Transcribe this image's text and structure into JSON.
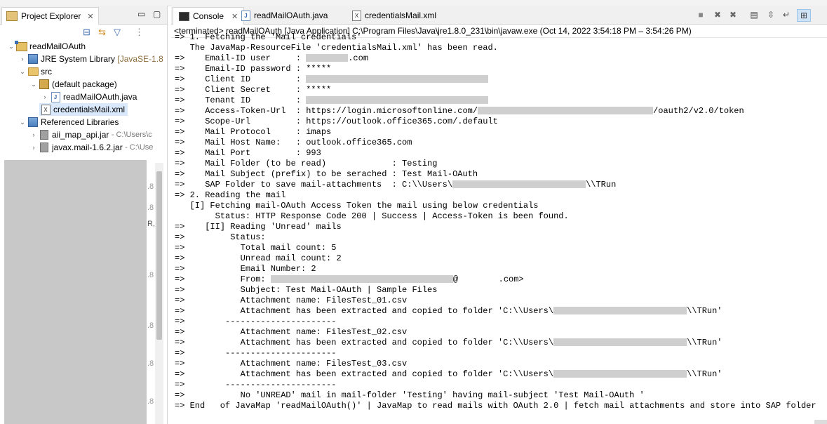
{
  "left_panel": {
    "tab_label": "Project Explorer",
    "tree": [
      {
        "label": "readMailOAuth",
        "sub": ""
      },
      {
        "label": "JRE System Library",
        "sub": "[JavaSE-1.8"
      },
      {
        "label": "src",
        "sub": ""
      },
      {
        "label": "(default package)",
        "sub": ""
      },
      {
        "label": "readMailOAuth.java",
        "sub": ""
      },
      {
        "label": "credentialsMail.xml",
        "sub": ""
      },
      {
        "label": "Referenced Libraries",
        "sub": ""
      },
      {
        "label": "aii_map_api.jar",
        "sub": "- C:\\Users\\c"
      },
      {
        "label": "javax.mail-1.6.2.jar",
        "sub": "- C:\\Use"
      }
    ],
    "peek_labels": [
      ".8",
      ".8",
      "R,",
      ".8",
      ".8",
      ".8",
      ".8",
      ".8"
    ]
  },
  "right_panel": {
    "tabs": [
      {
        "label": "Console",
        "active": true
      },
      {
        "label": "readMailOAuth.java",
        "active": false
      },
      {
        "label": "credentialsMail.xml",
        "active": false
      }
    ],
    "header": "<terminated> readMailOAuth [Java Application] C:\\Program Files\\Java\\jre1.8.0_231\\bin\\javaw.exe  (Oct 14, 2022 3:54:18 PM – 3:54:26 PM)"
  },
  "console": {
    "lines": [
      "=> 1. Fetching the 'Mail credentials'",
      "   The JavaMap-ResourceFile 'credentialsMail.xml' has been read.",
      "=>    Email-ID user     : ",
      "=>    Email-ID password : *****",
      "=>    Client ID         : ",
      "=>    Client Secret     : *****",
      "=>    Tenant ID         : ",
      "=>    Access-Token-Url  : https://login.microsoftonline.com/",
      "=>    Scope-Url         : https://outlook.office365.com/.default",
      "=>    Mail Protocol     : imaps",
      "=>    Mail Host Name:   : outlook.office365.com",
      "=>    Mail Port         : 993",
      "=>    Mail Folder (to be read)             : Testing",
      "=>    Mail Subject (prefix) to be serached : Test Mail-OAuth",
      "=>    SAP Folder to save mail-attachments  : C:\\\\Users\\",
      "=> 2. Reading the mail",
      "   [I] Fetching mail-OAuth Access Token the mail using below credentials",
      "        Status: HTTP Response Code 200 | Success | Access-Token is been found.",
      "=>    [II] Reading 'Unread' mails",
      "=>         Status:",
      "=>           Total mail count: 5",
      "=>           Unread mail count: 2",
      "=>           Email Number: 2",
      "=>           From: ",
      "=>           Subject: Test Mail-OAuth | Sample Files",
      "=>           Attachment name: FilesTest_01.csv",
      "=>           Attachment has been extracted and copied to folder 'C:\\\\Users\\",
      "=>        ----------------------",
      "=>           Attachment name: FilesTest_02.csv",
      "=>           Attachment has been extracted and copied to folder 'C:\\\\Users\\",
      "=>        ----------------------",
      "=>           Attachment name: FilesTest_03.csv",
      "=>           Attachment has been extracted and copied to folder 'C:\\\\Users\\",
      "=>        ----------------------",
      "=>           No 'UNREAD' mail in mail-folder 'Testing' having mail-subject 'Test Mail-OAuth '",
      "=> End   of JavaMap 'readMailOAuth()' | JavaMap to read mails with OAuth 2.0 | fetch mail attachments and store into SAP folder"
    ],
    "suffixes": [
      "",
      "",
      ".com",
      "",
      "",
      "",
      "",
      "/oauth2/v2.0/token",
      "",
      "",
      "",
      "",
      "",
      "",
      "\\\\TRun",
      "",
      "",
      "",
      "",
      "",
      "",
      "",
      "",
      "@        .com>",
      "",
      "",
      "\\\\TRun'",
      "",
      "",
      "\\\\TRun'",
      "",
      "",
      "\\\\TRun'",
      "",
      "",
      ""
    ]
  },
  "colors": {
    "accent_selection": "#d9e8fb",
    "redaction": "#cfcfcf"
  }
}
